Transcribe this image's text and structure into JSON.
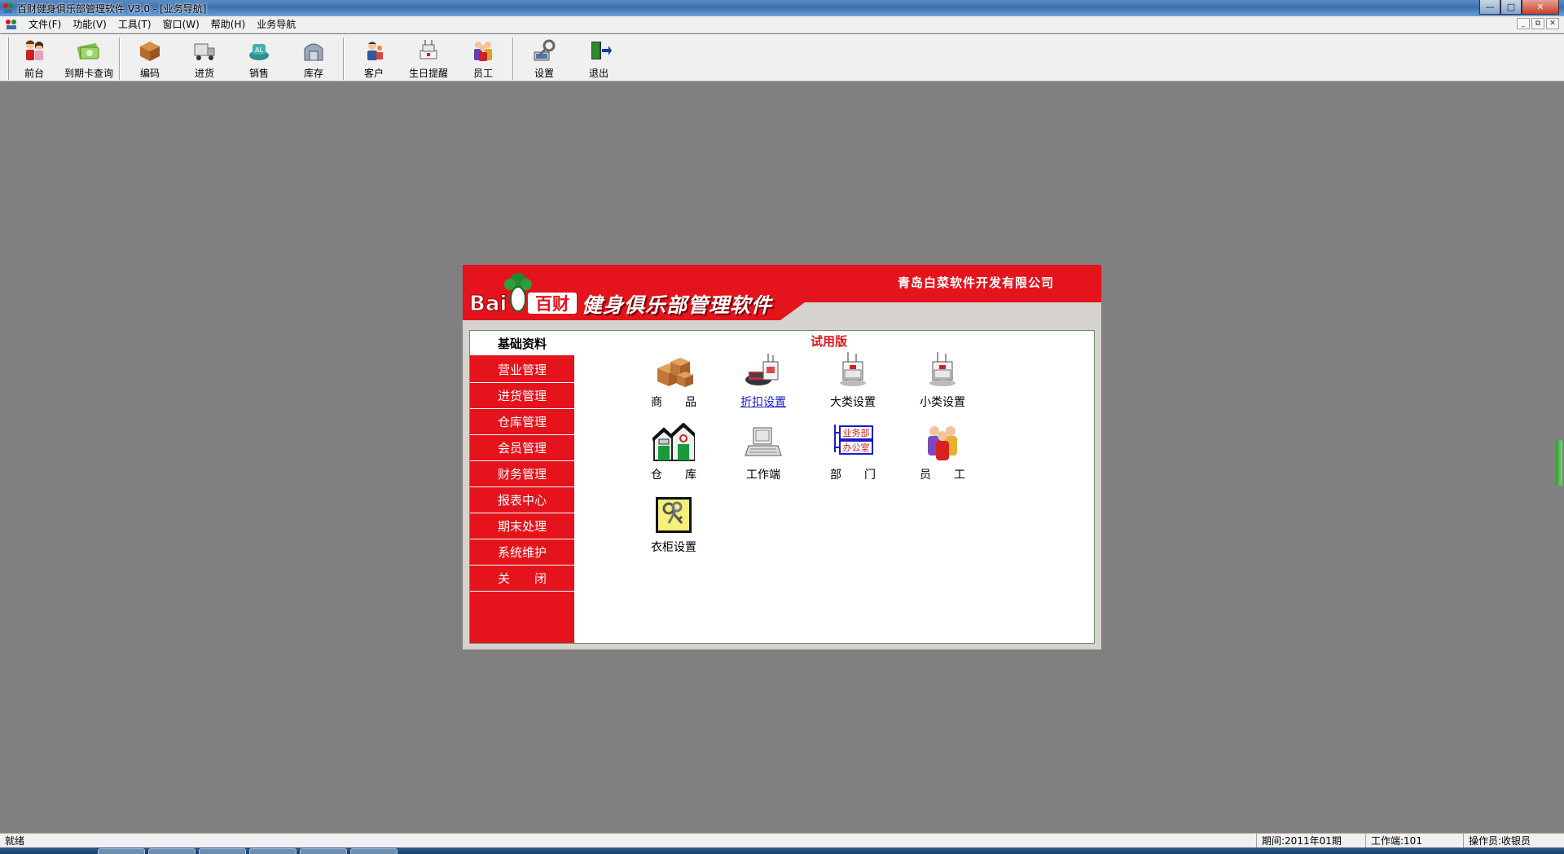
{
  "window": {
    "title": "百财健身俱乐部管理软件 V3.0 - [业务导航]"
  },
  "menu": {
    "items": [
      "文件(F)",
      "功能(V)",
      "工具(T)",
      "窗口(W)",
      "帮助(H)",
      "业务导航"
    ]
  },
  "toolbar": {
    "buttons": [
      {
        "label": "前台",
        "icon": "people-icon"
      },
      {
        "label": "到期卡查询",
        "icon": "card-icon"
      },
      {
        "label": "编码",
        "icon": "box-icon"
      },
      {
        "label": "进货",
        "icon": "truck-icon"
      },
      {
        "label": "销售",
        "icon": "sales-icon"
      },
      {
        "label": "库存",
        "icon": "warehouse-icon"
      },
      {
        "label": "客户",
        "icon": "customer-icon"
      },
      {
        "label": "生日提醒",
        "icon": "birthday-icon"
      },
      {
        "label": "员工",
        "icon": "staff-icon"
      },
      {
        "label": "设置",
        "icon": "settings-icon"
      },
      {
        "label": "退出",
        "icon": "exit-icon"
      }
    ]
  },
  "banner": {
    "logo_text": "Bai百财",
    "product_name": "健身俱乐部管理软件",
    "company": "青岛白菜软件开发有限公司"
  },
  "edition": "试用版",
  "sidebar": {
    "items": [
      "基础资料",
      "营业管理",
      "进货管理",
      "仓库管理",
      "会员管理",
      "财务管理",
      "报表中心",
      "期末处理",
      "系统维护",
      "关　　闭"
    ],
    "active_index": 0
  },
  "grid": {
    "items": [
      {
        "label": "商　　品",
        "icon": "goods-icon"
      },
      {
        "label": "折扣设置",
        "icon": "discount-icon",
        "link": true
      },
      {
        "label": "大类设置",
        "icon": "category-icon"
      },
      {
        "label": "小类设置",
        "icon": "subcategory-icon"
      },
      {
        "label": "仓　　库",
        "icon": "warehouse-building-icon"
      },
      {
        "label": "工作端",
        "icon": "terminal-icon"
      },
      {
        "label": "部　　门",
        "icon": "department-icon"
      },
      {
        "label": "员　　工",
        "icon": "employee-icon"
      },
      {
        "label": "衣柜设置",
        "icon": "locker-key-icon"
      }
    ],
    "department_tags": [
      "业务部",
      "办公室"
    ]
  },
  "statusbar": {
    "status": "就绪",
    "period": "期间:2011年01期",
    "workstation": "工作端:101",
    "operator": "操作员:收银员"
  },
  "colors": {
    "brand_red": "#e4131c",
    "desktop_gray": "#808080",
    "panel_gray": "#d6d3ce"
  }
}
